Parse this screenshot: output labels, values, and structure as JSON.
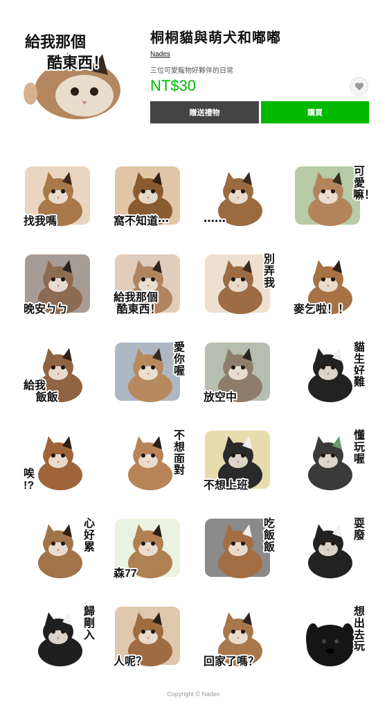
{
  "product": {
    "main_caption": "給我那個\n 酷東西！",
    "title": "桐桐貓與萌犬和嘟嘟",
    "author": "Nades",
    "description": "三位可愛寵物好夥伴的日常",
    "price": "NT$30",
    "gift_label": "贈送禮物",
    "buy_label": "購買",
    "favorite_icon": "heart-icon"
  },
  "stickers": [
    {
      "caption": "找我嗎",
      "subject": "calico-cat",
      "layout": "h",
      "bg": "#d9b58c",
      "fur": "#a9794a",
      "accent": "#3b2a20"
    },
    {
      "caption": "窩不知道⋯",
      "subject": "calico-cat",
      "layout": "h",
      "bg": "#c9955e",
      "fur": "#8a5a30",
      "accent": "#2f2118"
    },
    {
      "caption": "⋯⋯",
      "subject": "calico-cat",
      "layout": "h",
      "bg": "#ffffff",
      "fur": "#9b6b40",
      "accent": "#3a2a22"
    },
    {
      "caption": "可愛嘛！",
      "subject": "calico-cat",
      "layout": "v",
      "bg": "#7aa05c",
      "fur": "#b3845a",
      "accent": "#3a2c22"
    },
    {
      "caption": "晚安ㄅㄅ",
      "subject": "calico-cat",
      "layout": "h",
      "bg": "#5e4a3e",
      "fur": "#8d6b52",
      "accent": "#2a211c"
    },
    {
      "caption": "給我那個\n 酷東西！",
      "subject": "calico-cat",
      "layout": "h",
      "bg": "#c8a483",
      "fur": "#b18460",
      "accent": "#2d2420"
    },
    {
      "caption": "別弄我",
      "subject": "calico-cat",
      "layout": "v",
      "bg": "#e0c7a8",
      "fur": "#9d6c44",
      "accent": "#3a2a20"
    },
    {
      "caption": "麥乞啦！！",
      "subject": "calico-cat",
      "layout": "h",
      "bg": "#ffffff",
      "fur": "#a77244",
      "accent": "#2b201a"
    },
    {
      "caption": "給我\n    飯飯",
      "subject": "calico-cat",
      "layout": "h",
      "bg": "#ffffff",
      "fur": "#8e6443",
      "accent": "#2e231d"
    },
    {
      "caption": "愛你喔",
      "subject": "calico-cat",
      "layout": "v",
      "bg": "#6c7c94",
      "fur": "#b68a5e",
      "accent": "#3a2b22"
    },
    {
      "caption": "放空中",
      "subject": "calico-cat",
      "layout": "h",
      "bg": "#7a8a6e",
      "fur": "#8f7d6b",
      "accent": "#2d2620"
    },
    {
      "caption": "貓生好難",
      "subject": "tuxedo-cat",
      "layout": "v",
      "bg": "#ffffff",
      "fur": "#222222",
      "accent": "#eeeeee"
    },
    {
      "caption": "唉\n!?",
      "subject": "calico-cat",
      "layout": "h",
      "bg": "#ffffff",
      "fur": "#a0643a",
      "accent": "#2b201a"
    },
    {
      "caption": "不想面對",
      "subject": "calico-cat",
      "layout": "v",
      "bg": "#ffffff",
      "fur": "#b88457",
      "accent": "#2c221c"
    },
    {
      "caption": "不想上班",
      "subject": "tuxedo-cat",
      "layout": "h",
      "bg": "#d4c06a",
      "fur": "#2a2a2a",
      "accent": "#f0f0f0"
    },
    {
      "caption": "懂玩喔",
      "subject": "tuxedo-cat",
      "layout": "v",
      "bg": "#ffffff",
      "fur": "#3a3a3a",
      "accent": "#6a9a6a"
    },
    {
      "caption": "心好累",
      "subject": "calico-cat",
      "layout": "v",
      "bg": "#ffffff",
      "fur": "#a27449",
      "accent": "#2e231c"
    },
    {
      "caption": "森77",
      "subject": "calico-cat",
      "layout": "h",
      "bg": "#d8e8c8",
      "fur": "#b07f52",
      "accent": "#2b211b"
    },
    {
      "caption": "吃飯飯",
      "subject": "calico-cat",
      "layout": "v",
      "bg": "#2a2a2a",
      "fur": "#a36e44",
      "accent": "#eeeeee"
    },
    {
      "caption": "耍廢",
      "subject": "tuxedo-cat",
      "layout": "v",
      "bg": "#ffffff",
      "fur": "#222222",
      "accent": "#f2f2f2"
    },
    {
      "caption": "歸剛入",
      "subject": "tuxedo-cat",
      "layout": "v",
      "bg": "#ffffff",
      "fur": "#1f1f1f",
      "accent": "#f0f0f0"
    },
    {
      "caption": "人呢？",
      "subject": "calico-cat",
      "layout": "h",
      "bg": "#c59a6c",
      "fur": "#9f6c42",
      "accent": "#2c221b"
    },
    {
      "caption": "回家了嗎？",
      "subject": "calico-cat",
      "layout": "h",
      "bg": "#ffffff",
      "fur": "#a8784c",
      "accent": "#2f241d"
    },
    {
      "caption": "想出去玩",
      "subject": "black-dog",
      "layout": "v",
      "bg": "#ffffff",
      "fur": "#151515",
      "accent": "#444444"
    }
  ],
  "footer": "Copyright © Nades"
}
